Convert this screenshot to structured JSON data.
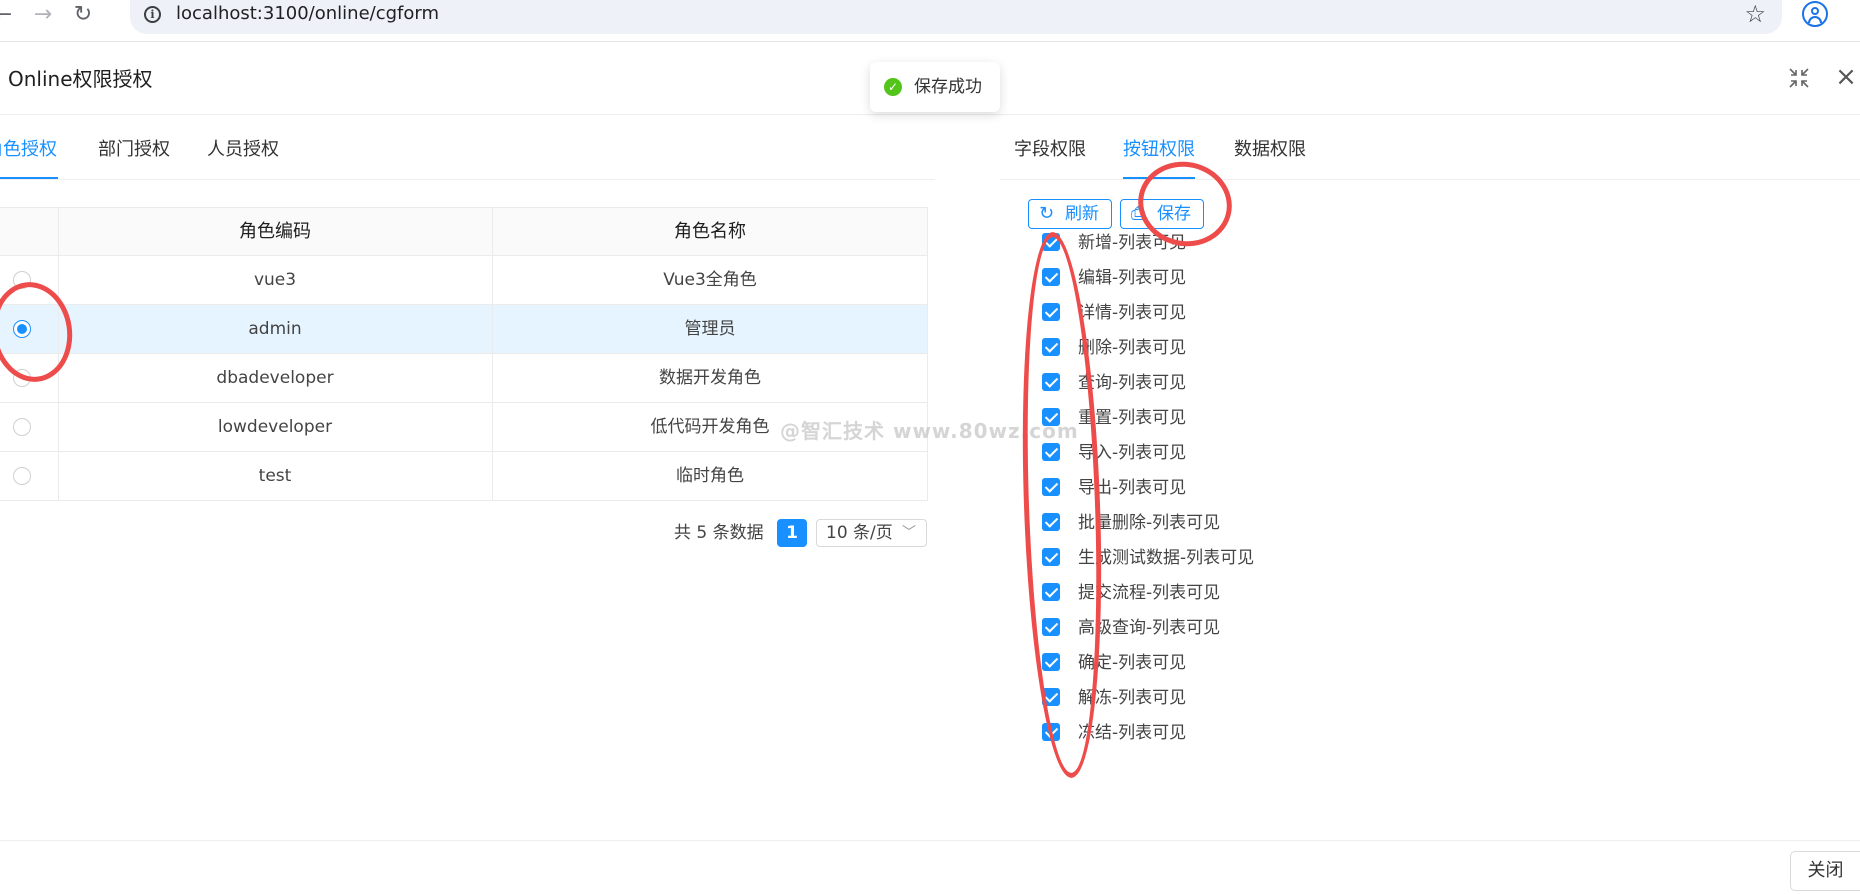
{
  "browser": {
    "url": "localhost:3100/online/cgform",
    "back_icon": "arrow-left-icon",
    "forward_icon": "arrow-right-icon",
    "reload_icon": "reload-icon"
  },
  "modal": {
    "title": "Online权限授权",
    "close_label": "关闭"
  },
  "toast": {
    "text": "保存成功"
  },
  "left_tabs": [
    {
      "label": "角色授权",
      "active": true
    },
    {
      "label": "部门授权",
      "active": false
    },
    {
      "label": "人员授权",
      "active": false
    }
  ],
  "table": {
    "columns": [
      "角色编码",
      "角色名称"
    ],
    "rows": [
      {
        "code": "vue3",
        "name": "Vue3全角色",
        "selected": false
      },
      {
        "code": "admin",
        "name": "管理员",
        "selected": true
      },
      {
        "code": "dbadeveloper",
        "name": "数据开发角色",
        "selected": false
      },
      {
        "code": "lowdeveloper",
        "name": "低代码开发角色",
        "selected": false
      },
      {
        "code": "test",
        "name": "临时角色",
        "selected": false
      }
    ]
  },
  "pagination": {
    "total": "共 5 条数据",
    "current_page": "1",
    "page_size": "10 条/页"
  },
  "right_tabs": [
    {
      "label": "字段权限",
      "active": false
    },
    {
      "label": "按钮权限",
      "active": true
    },
    {
      "label": "数据权限",
      "active": false
    }
  ],
  "toolbar": {
    "refresh_label": "刷新",
    "save_label": "保存"
  },
  "permissions": [
    "新增-列表可见",
    "编辑-列表可见",
    "详情-列表可见",
    "删除-列表可见",
    "查询-列表可见",
    "重置-列表可见",
    "导入-列表可见",
    "导出-列表可见",
    "批量删除-列表可见",
    "生成测试数据-列表可见",
    "提交流程-列表可见",
    "高级查询-列表可见",
    "确定-列表可见",
    "解冻-列表可见",
    "冻结-列表可见"
  ],
  "watermark": "@智汇技术 www.80wz.com",
  "colors": {
    "primary": "#1890ff",
    "success": "#52c41a",
    "annotation": "#ee4b4b",
    "selected_row": "#e6f4ff"
  }
}
